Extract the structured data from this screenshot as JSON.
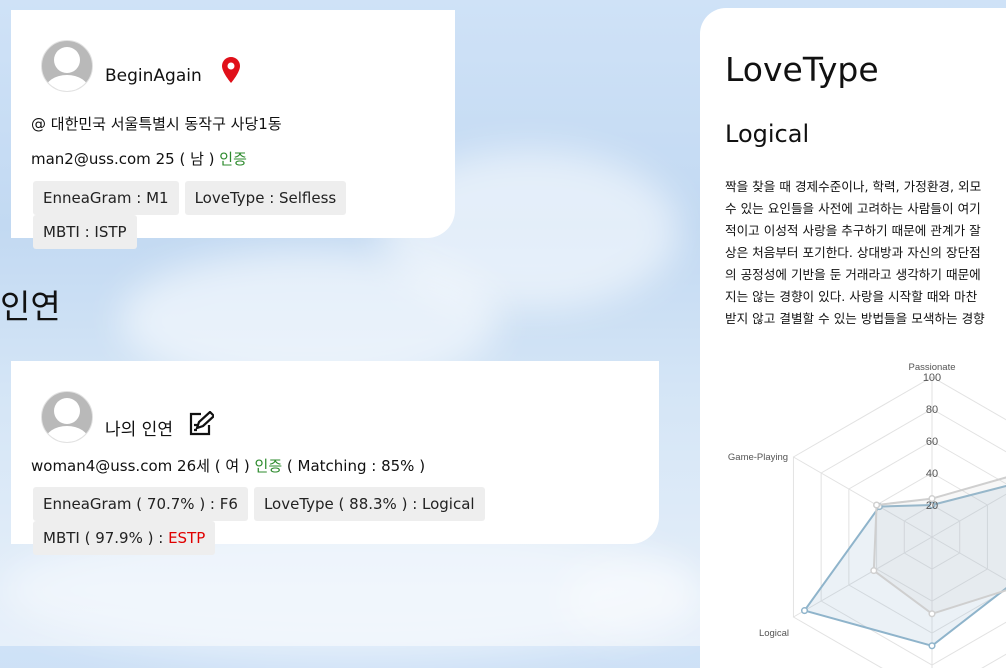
{
  "my_profile": {
    "username": "BeginAgain",
    "location": "@ 대한민국 서울특별시 동작구 사당1동",
    "email": "man2@uss.com",
    "age": "25",
    "gender": "( 남 )",
    "verified": "인증",
    "tags": [
      "EnneaGram : M1",
      "LoveType : Selfless",
      "MBTI : ISTP"
    ]
  },
  "section_title": "인연",
  "match_card": {
    "name": "나의 인연",
    "email": "woman4@uss.com",
    "age": "26세",
    "gender": "( 여 )",
    "verified": "인증",
    "matching": "( Matching : 85% )",
    "tags": [
      {
        "text": "EnneaGram ( 70.7% ) : F6",
        "highlight": ""
      },
      {
        "text": "LoveType ( 88.3% ) : Logical",
        "highlight": ""
      },
      {
        "text": "MBTI ( 97.9% ) : ",
        "highlight": "ESTP"
      }
    ]
  },
  "love_type_panel": {
    "title": "LoveType",
    "subtitle": "Logical",
    "description_lines": [
      "짝을 찾을 때 경제수준이나, 학력, 가정환경, 외모",
      "수 있는 요인들을 사전에 고려하는 사람들이 여기",
      "적이고 이성적 사랑을 추구하기 때문에 관계가 잘",
      "상은 처음부터 포기한다. 상대방과 자신의 장단점",
      "의 공정성에 기반을 둔 거래라고 생각하기 때문에",
      "지는 않는 경향이 있다. 사랑을 시작할 때와 마찬",
      "받지 않고 결별할 수 있는 방법들을 모색하는 경향"
    ]
  },
  "chart_data": {
    "type": "radar",
    "axes": [
      "Passionate",
      "",
      "",
      "",
      "Logical",
      "Game-Playing"
    ],
    "rlim": [
      0,
      100
    ],
    "ticks": [
      "20",
      "40",
      "60",
      "80",
      "100"
    ],
    "grid": true,
    "series": [
      {
        "values": [
          20,
          72,
          58,
          68,
          92,
          38
        ],
        "color": "#8fb4cb"
      },
      {
        "values": [
          24,
          95,
          62,
          48,
          42,
          40
        ],
        "color": "#cfcfcf"
      }
    ]
  },
  "colors": {
    "verified": "#2e8b2e",
    "highlight": "#e00000",
    "pin": "#e0101a"
  }
}
